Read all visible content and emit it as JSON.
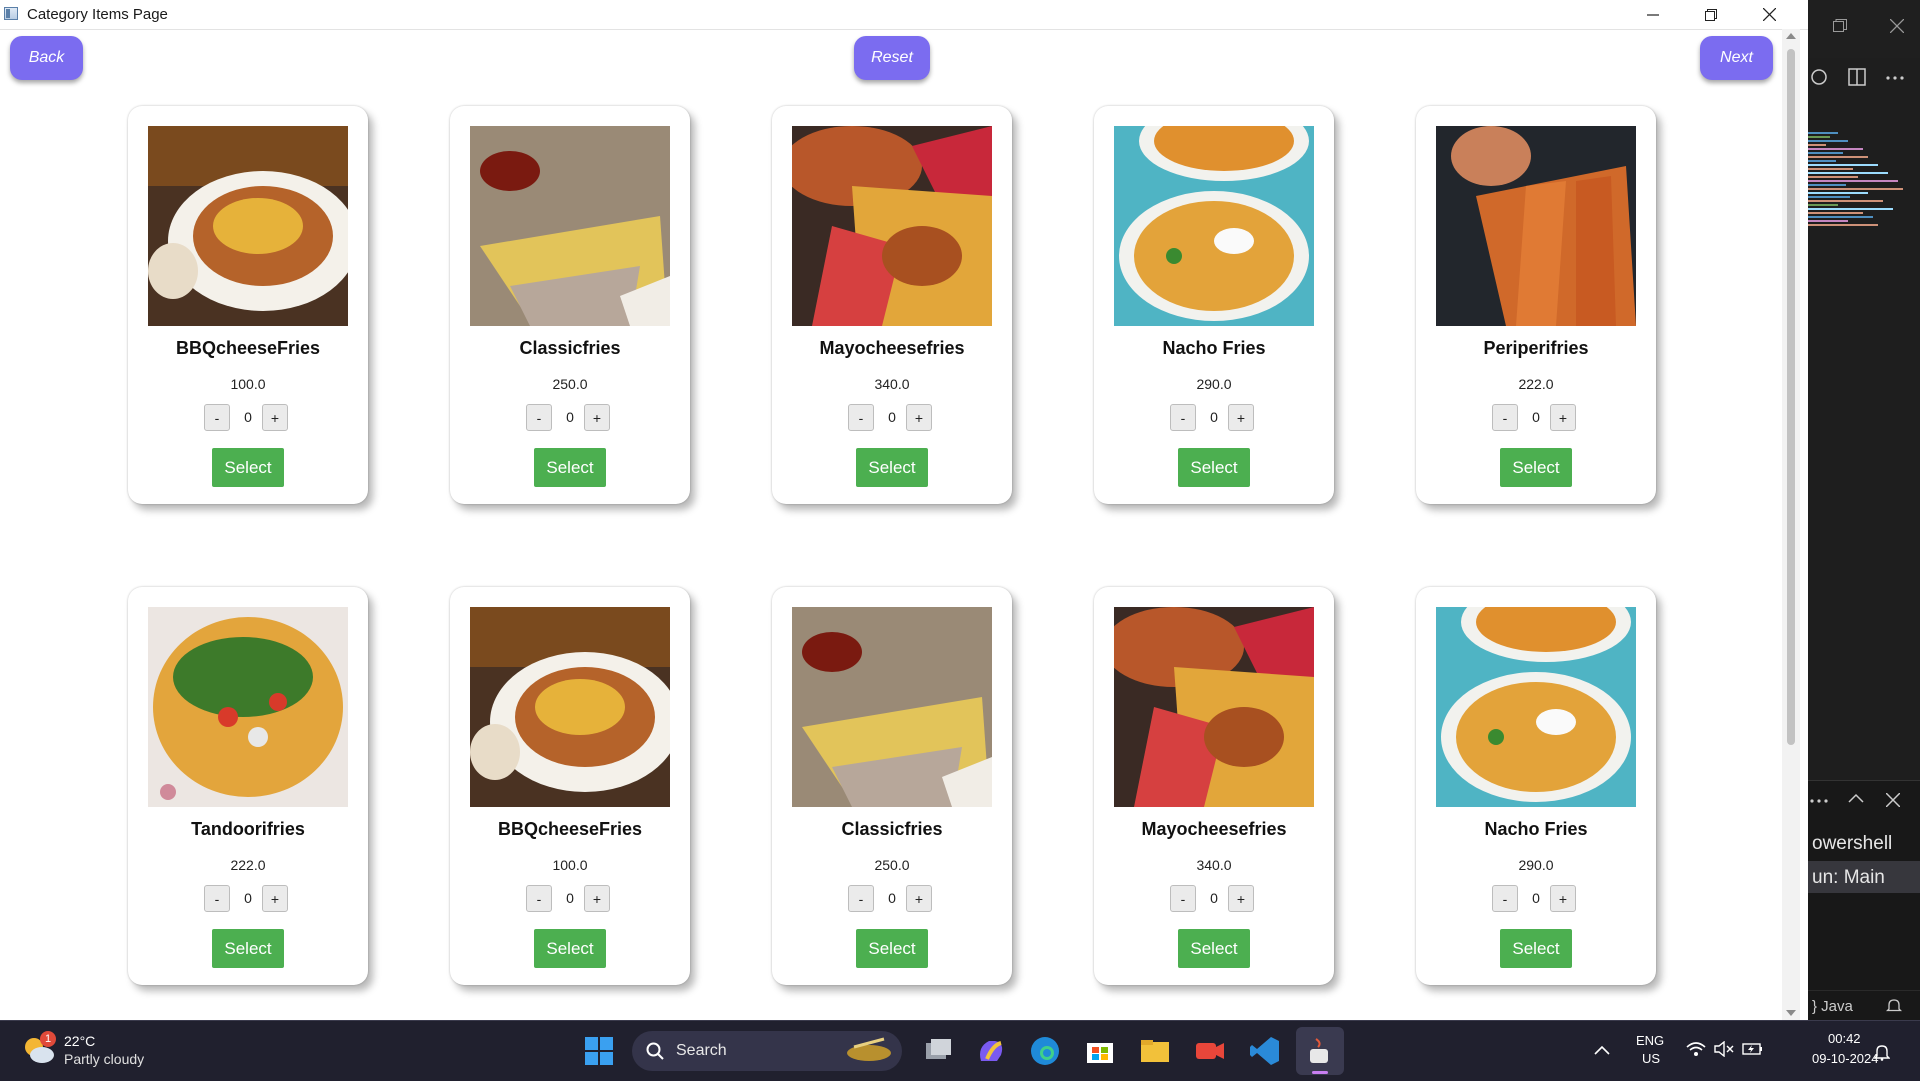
{
  "window": {
    "title": "Category Items Page"
  },
  "nav": {
    "back": "Back",
    "reset": "Reset",
    "next": "Next"
  },
  "quantity_controls": {
    "minus": "-",
    "plus": "+",
    "select": "Select"
  },
  "items": [
    {
      "name": "BBQcheeseFries",
      "price": "100.0",
      "qty": "0"
    },
    {
      "name": "Classicfries",
      "price": "250.0",
      "qty": "0"
    },
    {
      "name": "Mayocheesefries",
      "price": "340.0",
      "qty": "0"
    },
    {
      "name": "Nacho Fries",
      "price": "290.0",
      "qty": "0"
    },
    {
      "name": "Periperifries",
      "price": "222.0",
      "qty": "0"
    },
    {
      "name": "Tandoorifries",
      "price": "222.0",
      "qty": "0"
    },
    {
      "name": "BBQcheeseFries",
      "price": "100.0",
      "qty": "0"
    },
    {
      "name": "Classicfries",
      "price": "250.0",
      "qty": "0"
    },
    {
      "name": "Mayocheesefries",
      "price": "340.0",
      "qty": "0"
    },
    {
      "name": "Nacho Fries",
      "price": "290.0",
      "qty": "0"
    }
  ],
  "background_app": {
    "panel_line_1": "owershell",
    "panel_line_2": "un: Main",
    "status_lang": "} Java"
  },
  "taskbar": {
    "weather_temp": "22°C",
    "weather_desc": "Partly cloudy",
    "weather_badge": "1",
    "search_placeholder": "Search",
    "lang_1": "ENG",
    "lang_2": "US",
    "time": "00:42",
    "date": "09-10-2024"
  },
  "colors": {
    "nav_button": "#7b6cf0",
    "select_button": "#4caf50",
    "taskbar": "#20202e"
  }
}
